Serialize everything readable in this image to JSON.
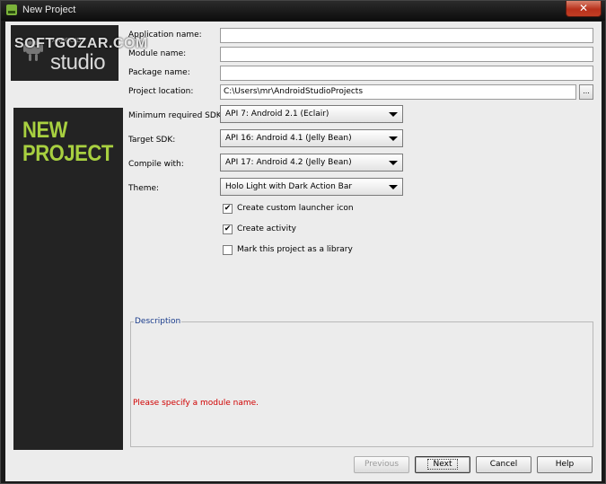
{
  "window": {
    "title": "New Project",
    "close_glyph": "✕"
  },
  "branding": {
    "watermark": "SOFTGOZAR.COM",
    "logo_small": "ANDROID",
    "logo_studio": "studio",
    "side_title_line1": "NEW",
    "side_title_line2": "PROJECT",
    "accent_color": "#a8d040"
  },
  "form": {
    "application_name": {
      "label": "Application name:",
      "value": ""
    },
    "module_name": {
      "label": "Module name:",
      "value": ""
    },
    "package_name": {
      "label": "Package name:",
      "value": ""
    },
    "project_location": {
      "label": "Project location:",
      "value": "C:\\Users\\mr\\AndroidStudioProjects",
      "browse_label": "..."
    },
    "min_sdk": {
      "label": "Minimum required SDK:",
      "value": "API 7: Android 2.1 (Eclair)"
    },
    "target_sdk": {
      "label": "Target SDK:",
      "value": "API 16: Android 4.1 (Jelly Bean)"
    },
    "compile_with": {
      "label": "Compile with:",
      "value": "API 17: Android 4.2 (Jelly Bean)"
    },
    "theme": {
      "label": "Theme:",
      "value": "Holo Light with Dark Action Bar"
    },
    "checkboxes": [
      {
        "label": "Create custom launcher icon",
        "checked": true,
        "mark": "✔"
      },
      {
        "label": "Create activity",
        "checked": true,
        "mark": "✔"
      },
      {
        "label": "Mark this project as a library",
        "checked": false,
        "mark": ""
      }
    ]
  },
  "description": {
    "legend": "Description",
    "error": "Please specify a module name.",
    "error_color": "#d00000"
  },
  "buttons": {
    "previous": "Previous",
    "next": "Next",
    "cancel": "Cancel",
    "help": "Help"
  }
}
